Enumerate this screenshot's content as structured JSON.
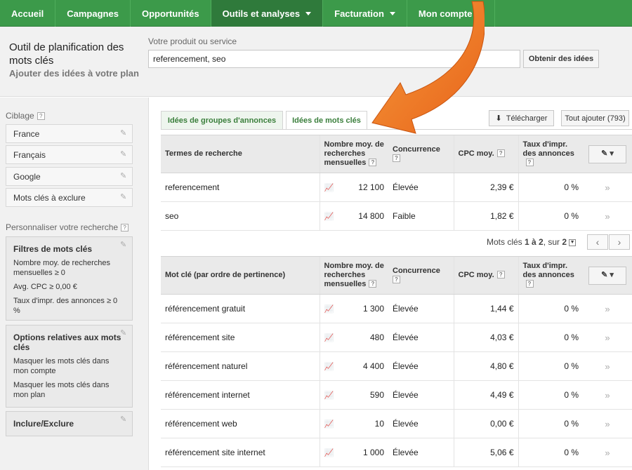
{
  "topnav": {
    "items": [
      {
        "label": "Accueil",
        "dropdown": false,
        "active": false
      },
      {
        "label": "Campagnes",
        "dropdown": false,
        "active": false
      },
      {
        "label": "Opportunités",
        "dropdown": false,
        "active": false
      },
      {
        "label": "Outils et analyses",
        "dropdown": true,
        "active": true
      },
      {
        "label": "Facturation",
        "dropdown": true,
        "active": false
      },
      {
        "label": "Mon compte",
        "dropdown": true,
        "active": false
      }
    ]
  },
  "header": {
    "title": "Outil de planification des mots clés",
    "subtitle": "Ajouter des idées à votre plan",
    "product_label": "Votre produit ou service",
    "product_value": "referencement, seo",
    "get_ideas_label": "Obtenir des idées"
  },
  "sidebar": {
    "targeting_label": "Ciblage",
    "targeting": [
      "France",
      "Français",
      "Google",
      "Mots clés à exclure"
    ],
    "customize_label": "Personnaliser votre recherche",
    "filters": {
      "title": "Filtres de mots clés",
      "lines": [
        "Nombre moy. de recherches mensuelles ≥ 0",
        "Avg. CPC ≥ 0,00 €",
        "Taux d'impr. des annonces ≥ 0 %"
      ]
    },
    "options": {
      "title": "Options relatives aux mots clés",
      "lines": [
        "Masquer les mots clés dans mon compte",
        "Masquer les mots clés dans mon plan"
      ]
    },
    "include_exclude": "Inclure/Exclure"
  },
  "tabs": {
    "ad_groups": "Idées de groupes d'annonces",
    "keywords": "Idées de mots clés",
    "download": "Télécharger",
    "add_all": "Tout ajouter (793)"
  },
  "table1": {
    "headers": {
      "term": "Termes de recherche",
      "searches": "Nombre moy. de recherches mensuelles",
      "competition": "Concurrence",
      "cpc": "CPC moy.",
      "impr": "Taux d'impr. des annonces"
    },
    "rows": [
      {
        "term": "referencement",
        "searches": "12 100",
        "competition": "Élevée",
        "cpc": "2,39 €",
        "impr": "0 %"
      },
      {
        "term": "seo",
        "searches": "14 800",
        "competition": "Faible",
        "cpc": "1,82 €",
        "impr": "0 %"
      }
    ]
  },
  "pager": {
    "prefix": "Mots clés ",
    "range": "1 à 2",
    "middle": ", sur ",
    "total": "2"
  },
  "table2": {
    "headers": {
      "term": "Mot clé (par ordre de pertinence)",
      "searches": "Nombre moy. de recherches mensuelles",
      "competition": "Concurrence",
      "cpc": "CPC moy.",
      "impr": "Taux d'impr. des annonces"
    },
    "rows": [
      {
        "term": "référencement gratuit",
        "searches": "1 300",
        "competition": "Élevée",
        "cpc": "1,44 €",
        "impr": "0 %"
      },
      {
        "term": "référencement site",
        "searches": "480",
        "competition": "Élevée",
        "cpc": "4,03 €",
        "impr": "0 %"
      },
      {
        "term": "référencement naturel",
        "searches": "4 400",
        "competition": "Élevée",
        "cpc": "4,80 €",
        "impr": "0 %"
      },
      {
        "term": "référencement internet",
        "searches": "590",
        "competition": "Élevée",
        "cpc": "4,49 €",
        "impr": "0 %"
      },
      {
        "term": "référencement web",
        "searches": "10",
        "competition": "Élevée",
        "cpc": "0,00 €",
        "impr": "0 %"
      },
      {
        "term": "référencement site internet",
        "searches": "1 000",
        "competition": "Élevée",
        "cpc": "5,06 €",
        "impr": "0 %"
      }
    ]
  },
  "colors": {
    "nav_green": "#3c9a4a",
    "nav_active": "#2f7a3b",
    "arrow_orange": "#f07a22"
  }
}
